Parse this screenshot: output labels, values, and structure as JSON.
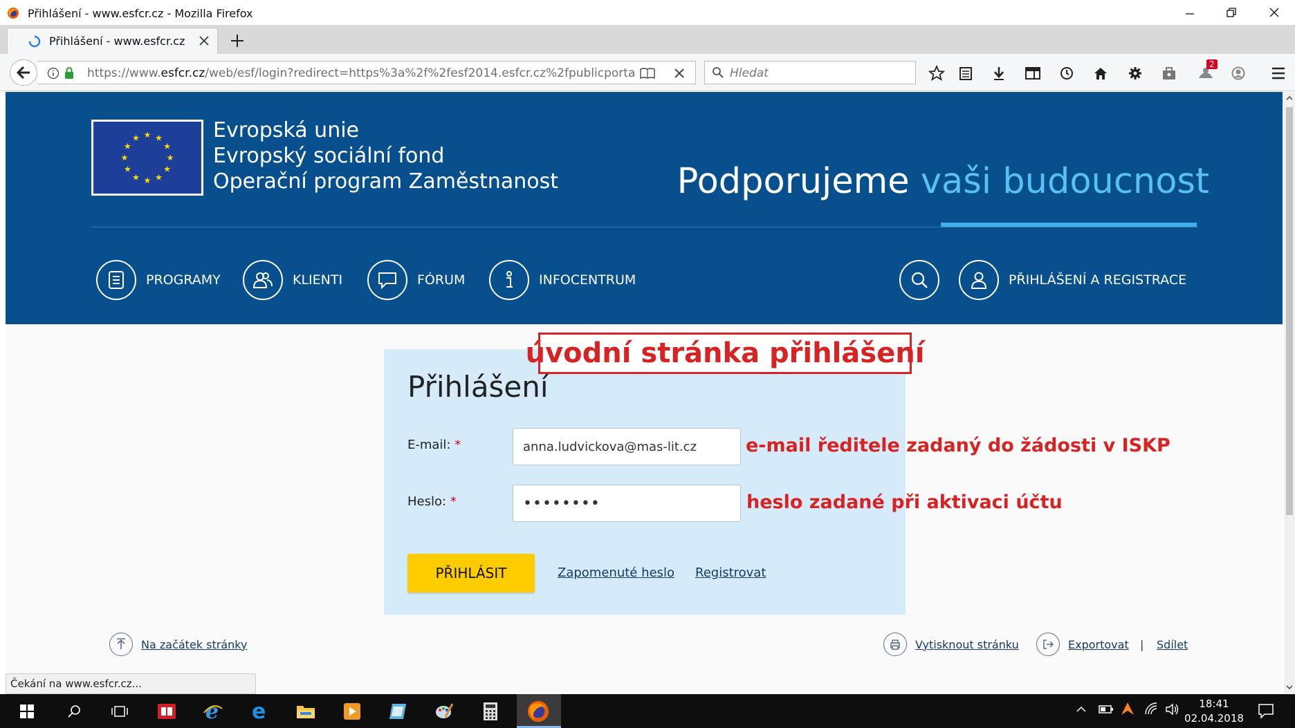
{
  "window": {
    "title": "Přihlášení - www.esfcr.cz - Mozilla Firefox"
  },
  "tab": {
    "title": "Přihlášení - www.esfcr.cz"
  },
  "toolbar": {
    "url_prefix": "https://www.",
    "url_domain": "esfcr.cz",
    "url_rest": "/web/esf/login?redirect=https%3a%2f%2fesf2014.esfcr.cz%2fpublicporta",
    "search_placeholder": "Hledat",
    "notification_count": "2"
  },
  "header": {
    "eu_lines": [
      "Evropská unie",
      "Evropský sociální fond",
      "Operační program Zaměstnanost"
    ],
    "slogan_main": "Podporujeme ",
    "slogan_accent": "vaši budoucnost",
    "nav": [
      {
        "label": "PROGRAMY",
        "icon": "document-icon"
      },
      {
        "label": "KLIENTI",
        "icon": "users-icon"
      },
      {
        "label": "FÓRUM",
        "icon": "chat-icon"
      },
      {
        "label": "INFOCENTRUM",
        "icon": "info-icon"
      }
    ],
    "login_register": "PŘIHLÁŠENÍ A REGISTRACE"
  },
  "login": {
    "title": "Přihlášení",
    "email_label": "E-mail:",
    "email_value": "anna.ludvickova@mas-lit.cz",
    "password_label": "Heslo:",
    "password_value": "••••••••",
    "required_mark": "*",
    "submit": "PŘIHLÁSIT",
    "forgot": "Zapomenuté heslo",
    "register": "Registrovat"
  },
  "annotations": {
    "title": "úvodní stránka přihlášení",
    "email_note": "e-mail ředitele zadaný do žádosti v ISKP",
    "password_note": "heslo zadané při aktivaci účtu"
  },
  "footer": {
    "top": "Na začátek stránky",
    "print": "Vytisknout stránku",
    "export": "Exportovat",
    "separator": "|",
    "share": "Sdílet"
  },
  "statusbar": {
    "text": "Čekání na www.esfcr.cz..."
  },
  "clock": {
    "time": "18:41",
    "date": "02.04.2018"
  },
  "colors": {
    "header": "#084f8e",
    "accent": "#59c0f2",
    "button": "#ffcc00",
    "annotation": "#d62424"
  }
}
